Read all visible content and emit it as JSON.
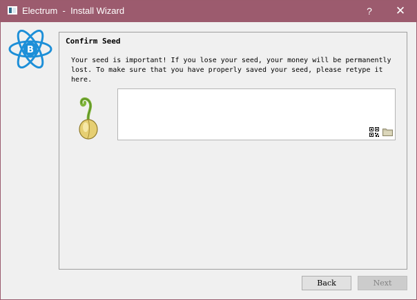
{
  "window": {
    "title": "Electrum  -  Install Wizard",
    "help_label": "?",
    "close_label": "✕",
    "titlebar_color": "#9c5b6e"
  },
  "page": {
    "heading": "Confirm Seed",
    "message": "Your seed is important! If you lose your seed, your money will be permanently lost. To make sure that you have properly saved your seed, please retype it here.",
    "seed_input": {
      "value": ""
    }
  },
  "icons": [
    "electrum-logo-icon",
    "sprout-icon",
    "qr-code-icon",
    "folder-icon"
  ],
  "buttons": {
    "back": "Back",
    "next": "Next"
  },
  "colors": {
    "accent": "#1d8fd8",
    "disabled_text": "#838383"
  }
}
